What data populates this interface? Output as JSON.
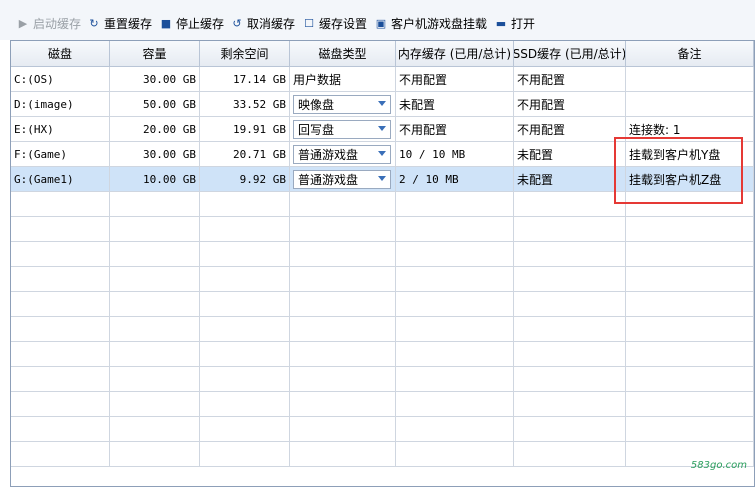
{
  "toolbar": {
    "start_cache": "启动缓存",
    "reset_cache": "重置缓存",
    "stop_cache": "停止缓存",
    "cancel_cache": "取消缓存",
    "cache_settings": "缓存设置",
    "mount_game_disk": "客户机游戏盘挂载",
    "open": "打开"
  },
  "table": {
    "headers": {
      "disk": "磁盘",
      "capacity": "容量",
      "free_space": "剩余空间",
      "disk_type": "磁盘类型",
      "memory_cache": "内存缓存 (已用/总计)",
      "ssd_cache": "SSD缓存 (已用/总计)",
      "remark": "备注"
    },
    "rows": [
      {
        "disk": "C:(OS)",
        "capacity": "30.00 GB",
        "free": "17.14 GB",
        "type": "用户数据",
        "mem": "不用配置",
        "ssd": "不用配置",
        "remark": ""
      },
      {
        "disk": "D:(image)",
        "capacity": "50.00 GB",
        "free": "33.52 GB",
        "type": "映像盘",
        "mem": "未配置",
        "ssd": "不用配置",
        "remark": ""
      },
      {
        "disk": "E:(HX)",
        "capacity": "20.00 GB",
        "free": "19.91 GB",
        "type": "回写盘",
        "mem": "不用配置",
        "ssd": "不用配置",
        "remark": "连接数: 1"
      },
      {
        "disk": "F:(Game)",
        "capacity": "30.00 GB",
        "free": "20.71 GB",
        "type": "普通游戏盘",
        "mem": "10 / 10 MB",
        "ssd": "未配置",
        "remark": "挂载到客户机Y盘"
      },
      {
        "disk": "G:(Game1)",
        "capacity": "10.00 GB",
        "free": "9.92 GB",
        "type": "普通游戏盘",
        "mem": "2 / 10 MB",
        "ssd": "未配置",
        "remark": "挂载到客户机Z盘"
      }
    ]
  },
  "watermark": "583go.com",
  "colors": {
    "selected_row": "#cfe3f8",
    "highlight_box": "#e53935"
  }
}
